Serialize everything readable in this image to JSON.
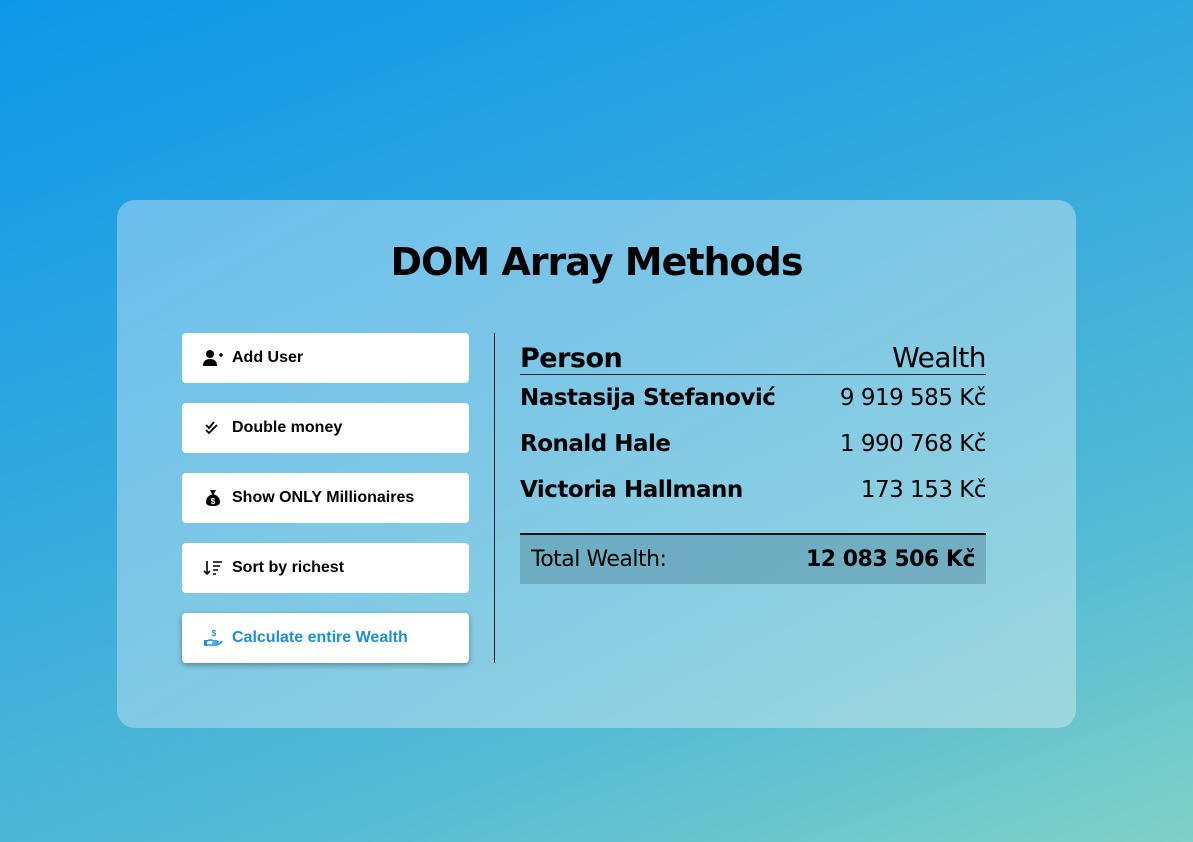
{
  "title": "DOM Array Methods",
  "buttons": [
    {
      "label": "Add User",
      "icon": "add-user-icon"
    },
    {
      "label": "Double money",
      "icon": "double-check-icon"
    },
    {
      "label": "Show ONLY Millionaires",
      "icon": "money-bag-icon"
    },
    {
      "label": "Sort by richest",
      "icon": "sort-desc-icon"
    },
    {
      "label": "Calculate entire Wealth",
      "icon": "hand-dollar-icon"
    }
  ],
  "table": {
    "person_header": "Person",
    "wealth_header": "Wealth",
    "rows": [
      {
        "name": "Nastasija Stefanović",
        "wealth": "9 919 585 Kč"
      },
      {
        "name": "Ronald Hale",
        "wealth": "1 990 768 Kč"
      },
      {
        "name": "Victoria Hallmann",
        "wealth": "173 153 Kč"
      }
    ]
  },
  "total": {
    "label": "Total Wealth:",
    "value": "12 083 506 Kč"
  },
  "colors": {
    "accent": "#1d8fd6"
  }
}
